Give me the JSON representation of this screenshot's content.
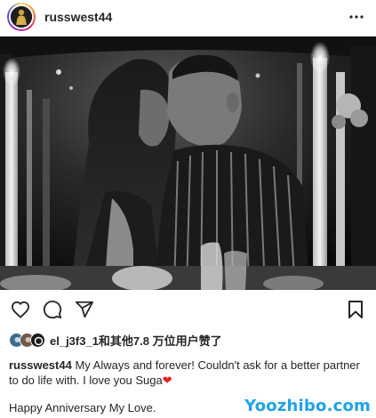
{
  "header": {
    "username": "russwest44",
    "more_icon": "more-horizontal-icon"
  },
  "actions": {
    "like_icon": "heart-outline-icon",
    "comment_icon": "comment-bubble-icon",
    "share_icon": "paper-plane-icon",
    "save_icon": "bookmark-icon"
  },
  "likes": {
    "text": "el_j3f3_1和其他7.8 万位用户赞了"
  },
  "caption": {
    "username": "russwest44",
    "text": "My Always and forever! Couldn't ask for a better partner to do life with. I love you Suga",
    "emoji": "❤",
    "line2": "Happy Anniversary My Love."
  },
  "watermark": {
    "text": "Yoozhibo.com"
  },
  "colors": {
    "heart_emoji": "#ed1c24",
    "watermark": "#1fa3ea",
    "text": "#262626"
  }
}
